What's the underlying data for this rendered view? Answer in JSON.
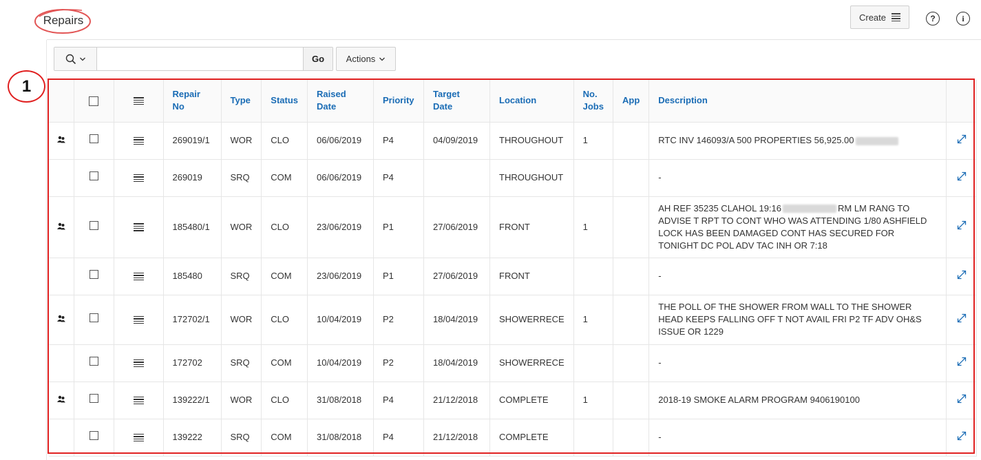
{
  "header": {
    "title": "Repairs",
    "create_label": "Create",
    "help_icon": "help-icon",
    "info_icon": "info-icon"
  },
  "toolbar": {
    "search_icon": "search-icon",
    "search_value": "",
    "go_label": "Go",
    "actions_label": "Actions"
  },
  "callout": {
    "number": "1"
  },
  "colors": {
    "accent": "#1a6cb5",
    "highlight": "#e02020"
  },
  "table": {
    "columns": {
      "repair_no_1": "Repair",
      "repair_no_2": "No",
      "type": "Type",
      "status": "Status",
      "raised_1": "Raised",
      "raised_2": "Date",
      "priority": "Priority",
      "target_1": "Target",
      "target_2": "Date",
      "location": "Location",
      "jobs_1": "No.",
      "jobs_2": "Jobs",
      "app": "App",
      "description": "Description"
    },
    "rows": [
      {
        "repair_no": "269019/1",
        "type": "WOR",
        "status": "CLO",
        "raised": "06/06/2019",
        "priority": "P4",
        "target": "04/09/2019",
        "location": "THROUGHOUT",
        "jobs": "1",
        "app": "",
        "description": "RTC INV 146093/A 500 PROPERTIES 56,925.00",
        "desc_after": ""
      },
      {
        "repair_no": "269019",
        "type": "SRQ",
        "status": "COM",
        "raised": "06/06/2019",
        "priority": "P4",
        "target": "",
        "location": "THROUGHOUT",
        "jobs": "",
        "app": "",
        "description": "-",
        "desc_after": ""
      },
      {
        "repair_no": "185480/1",
        "type": "WOR",
        "status": "CLO",
        "raised": "23/06/2019",
        "priority": "P1",
        "target": "27/06/2019",
        "location": "FRONT",
        "jobs": "1",
        "app": "",
        "description": "AH REF 35235 CLAHOL 19:16",
        "desc_after": "RM LM RANG TO ADVISE T RPT TO CONT WHO WAS ATTENDING 1/80 ASHFIELD LOCK HAS BEEN DAMAGED CONT HAS SECURED FOR TONIGHT DC POL ADV TAC INH OR 7:18"
      },
      {
        "repair_no": "185480",
        "type": "SRQ",
        "status": "COM",
        "raised": "23/06/2019",
        "priority": "P1",
        "target": "27/06/2019",
        "location": "FRONT",
        "jobs": "",
        "app": "",
        "description": "-",
        "desc_after": ""
      },
      {
        "repair_no": "172702/1",
        "type": "WOR",
        "status": "CLO",
        "raised": "10/04/2019",
        "priority": "P2",
        "target": "18/04/2019",
        "location": "SHOWERRECE",
        "jobs": "1",
        "app": "",
        "description": "THE POLL OF THE SHOWER FROM WALL TO THE SHOWER HEAD KEEPS FALLING OFF T NOT AVAIL FRI P2 TF ADV OH&S ISSUE OR 1229",
        "desc_after": ""
      },
      {
        "repair_no": "172702",
        "type": "SRQ",
        "status": "COM",
        "raised": "10/04/2019",
        "priority": "P2",
        "target": "18/04/2019",
        "location": "SHOWERRECE",
        "jobs": "",
        "app": "",
        "description": "-",
        "desc_after": ""
      },
      {
        "repair_no": "139222/1",
        "type": "WOR",
        "status": "CLO",
        "raised": "31/08/2018",
        "priority": "P4",
        "target": "21/12/2018",
        "location": "COMPLETE",
        "jobs": "1",
        "app": "",
        "description": "2018-19 SMOKE ALARM PROGRAM 9406190100",
        "desc_after": ""
      },
      {
        "repair_no": "139222",
        "type": "SRQ",
        "status": "COM",
        "raised": "31/08/2018",
        "priority": "P4",
        "target": "21/12/2018",
        "location": "COMPLETE",
        "jobs": "",
        "app": "",
        "description": "-",
        "desc_after": ""
      }
    ]
  }
}
